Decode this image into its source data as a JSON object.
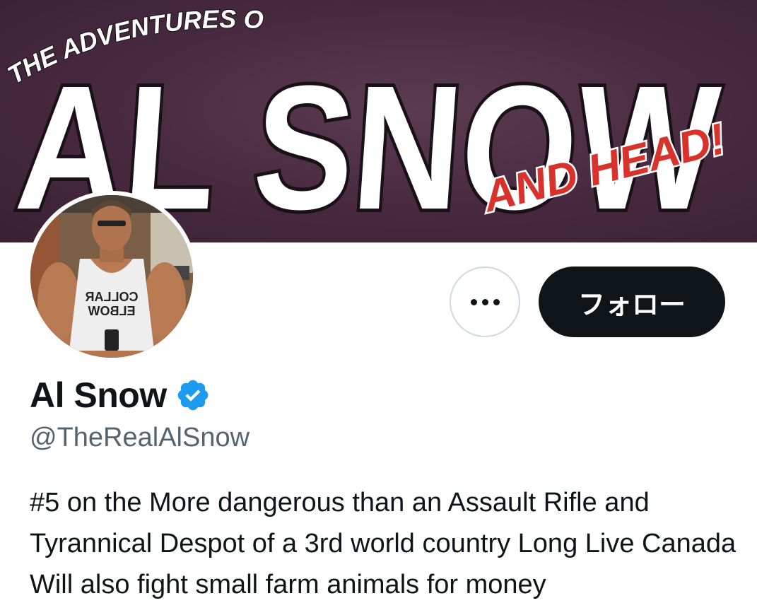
{
  "banner": {
    "line1": "THE ADVENTURES OF",
    "line2": "AL SNOW",
    "line3": "AND HEAD!",
    "bg_color": "#47293f",
    "accent_red": "#d8322c"
  },
  "profile": {
    "avatar_icon": "profile-photo",
    "avatar_shirt_text_1": "COLLAR",
    "avatar_shirt_text_2": "ELBOW",
    "display_name": "Al Snow",
    "verified_icon": "verified-badge-icon",
    "handle": "@TheRealAlSnow",
    "bio": "#5 on the More dangerous than an Assault Rifle and Tyrannical Despot of a 3rd world country Long Live Canada Will also fight small farm animals for money"
  },
  "actions": {
    "more_icon": "more-options-icon",
    "follow_label": "フォロー"
  },
  "colors": {
    "verified_blue": "#1d9bf0",
    "text_primary": "#0f1419",
    "text_secondary": "#536471",
    "button_dark": "#0f1419"
  }
}
